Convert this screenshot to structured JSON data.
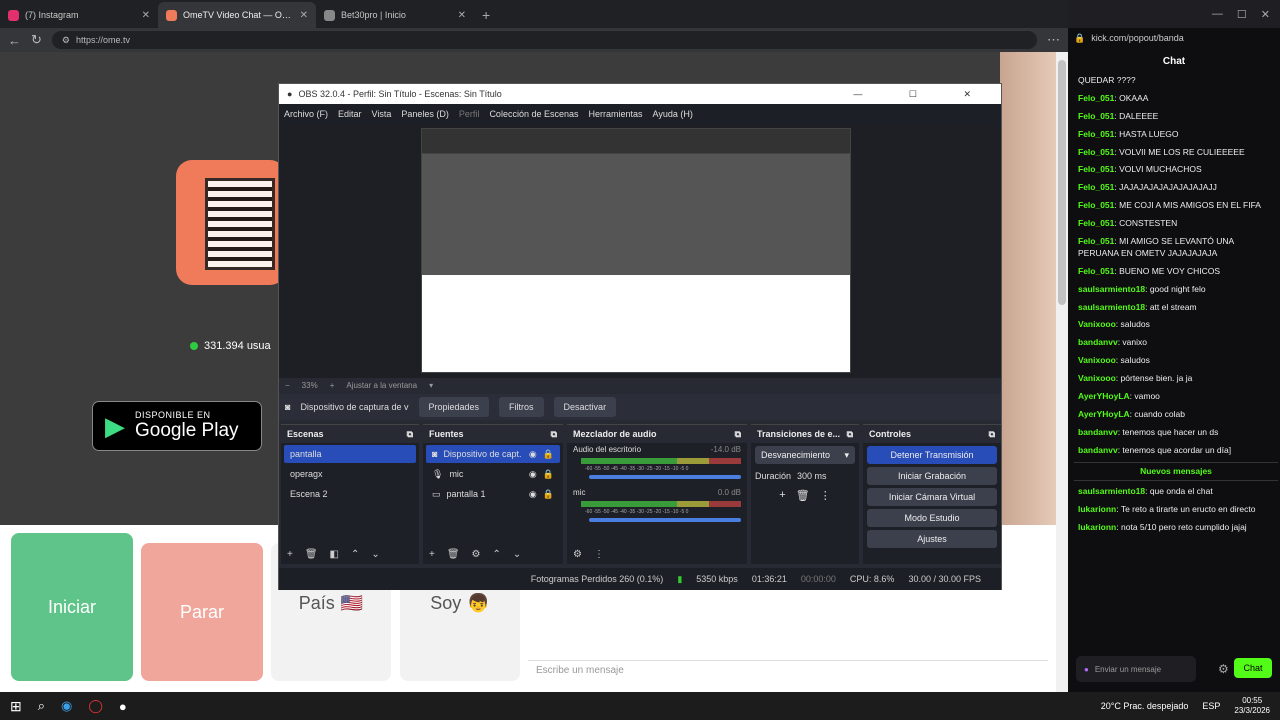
{
  "browser": {
    "tabs": [
      {
        "label": "(7) Instagram",
        "color": "#e1306c",
        "active": false
      },
      {
        "label": "OmeTV Video Chat — Omegl",
        "color": "#f07b5a",
        "active": true
      },
      {
        "label": "Bet30pro | Inicio",
        "color": "#888888",
        "active": false
      }
    ],
    "url": "https://ome.tv",
    "online_count": "331.394 usua",
    "gplay_small": "DISPONIBLE EN",
    "gplay_big": "Google Play",
    "btn_start": "Iniciar",
    "btn_stop": "Parar",
    "country_label": "País",
    "gender_label": "Soy",
    "message_placeholder": "Escribe un mensaje"
  },
  "obs": {
    "title": "OBS 32.0.4 - Perfil: Sin Título - Escenas: Sin Título",
    "menu": [
      "Archivo (F)",
      "Editar",
      "Vista",
      "Paneles (D)",
      "Perfil",
      "Colección de Escenas",
      "Herramientas",
      "Ayuda (H)"
    ],
    "zoom": "33%",
    "fit": "Ajustar a la ventana",
    "source_name": "Dispositivo de captura de v",
    "props_btn": "Propiedades",
    "filters_btn": "Filtros",
    "disable_btn": "Desactivar",
    "scenes_title": "Escenas",
    "scenes": [
      "pantalla",
      "operagx",
      "Escena 2"
    ],
    "sources_title": "Fuentes",
    "sources": [
      "Dispositivo de capt.",
      "mic",
      "pantalla 1"
    ],
    "mixer_title": "Mezclador de audio",
    "mixer": [
      {
        "name": "Audio del escritorio",
        "db": "-14.0 dB",
        "level": 0.62
      },
      {
        "name": "mic",
        "db": "0.0 dB",
        "level": 0.98
      }
    ],
    "scale": "-60 -55 -50 -45 -40 -35 -30 -25 -20 -15 -10 -5 0",
    "transitions_title": "Transiciones de e...",
    "transition": "Desvanecimiento",
    "duration_label": "Duración",
    "duration": "300 ms",
    "controls_title": "Controles",
    "controls": [
      "Detener Transmisión",
      "Iniciar Grabación",
      "Iniciar Cámara Virtual",
      "Modo Estudio",
      "Ajustes"
    ],
    "status": {
      "dropped": "Fotogramas Perdidos 260 (0.1%)",
      "bitrate": "5350 kbps",
      "live": "01:36:21",
      "rec": "00:00:00",
      "cpu": "CPU: 8.6%",
      "fps": "30.00 / 30.00 FPS"
    }
  },
  "kick": {
    "url": "kick.com/popout/banda",
    "header": "Chat",
    "messages": [
      {
        "user": "",
        "text": "QUEDAR ????"
      },
      {
        "user": "Felo_051",
        "text": "OKAAA"
      },
      {
        "user": "Felo_051",
        "text": "DALEEEE"
      },
      {
        "user": "Felo_051",
        "text": "HASTA LUEGO"
      },
      {
        "user": "Felo_051",
        "text": "VOLVII ME LOS RE CULIEEEEE"
      },
      {
        "user": "Felo_051",
        "text": "VOLVI MUCHACHOS"
      },
      {
        "user": "Felo_051",
        "text": "JAJAJAJAJAJAJAJAJAJJ"
      },
      {
        "user": "Felo_051",
        "text": "ME COJI A MIS AMIGOS EN EL FIFA"
      },
      {
        "user": "Felo_051",
        "text": "CONSTESTEN"
      },
      {
        "user": "Felo_051",
        "text": "MI AMIGO SE LEVANTÓ UNA PERUANA EN OMETV JAJAJAJAJA"
      },
      {
        "user": "Felo_051",
        "text": "BUENO ME VOY CHICOS"
      },
      {
        "user": "saulsarmiento18",
        "text": "good night felo"
      },
      {
        "user": "saulsarmiento18",
        "text": "att el stream"
      },
      {
        "user": "Vanixooo",
        "text": "saludos"
      },
      {
        "user": "bandanvv",
        "text": "vanixo"
      },
      {
        "user": "Vanixooo",
        "text": "saludos"
      },
      {
        "user": "Vanixooo",
        "text": "pórtense bien. ja ja"
      },
      {
        "user": "AyerYHoyLA",
        "text": "vamoo"
      },
      {
        "user": "AyerYHoyLA",
        "text": "cuando colab"
      },
      {
        "user": "bandanvv",
        "text": "tenemos que hacer un ds"
      },
      {
        "user": "bandanvv",
        "text": "tenemos que acordar un día]"
      }
    ],
    "new_label": "Nuevos mensajes",
    "new_messages": [
      {
        "user": "saulsarmiento18",
        "text": "que onda el chat"
      },
      {
        "user": "lukarionn",
        "text": "Te reto a tirarte un eructo en directo"
      },
      {
        "user": "lukarionn",
        "text": "nota 5/10 pero reto cumplido jajaj"
      }
    ],
    "input_placeholder": "Enviar un mensaje",
    "send": "Chat"
  },
  "taskbar": {
    "weather": "20°C  Prac. despejado",
    "lang": "ESP",
    "time": "00:55",
    "date": "23/3/2026"
  }
}
